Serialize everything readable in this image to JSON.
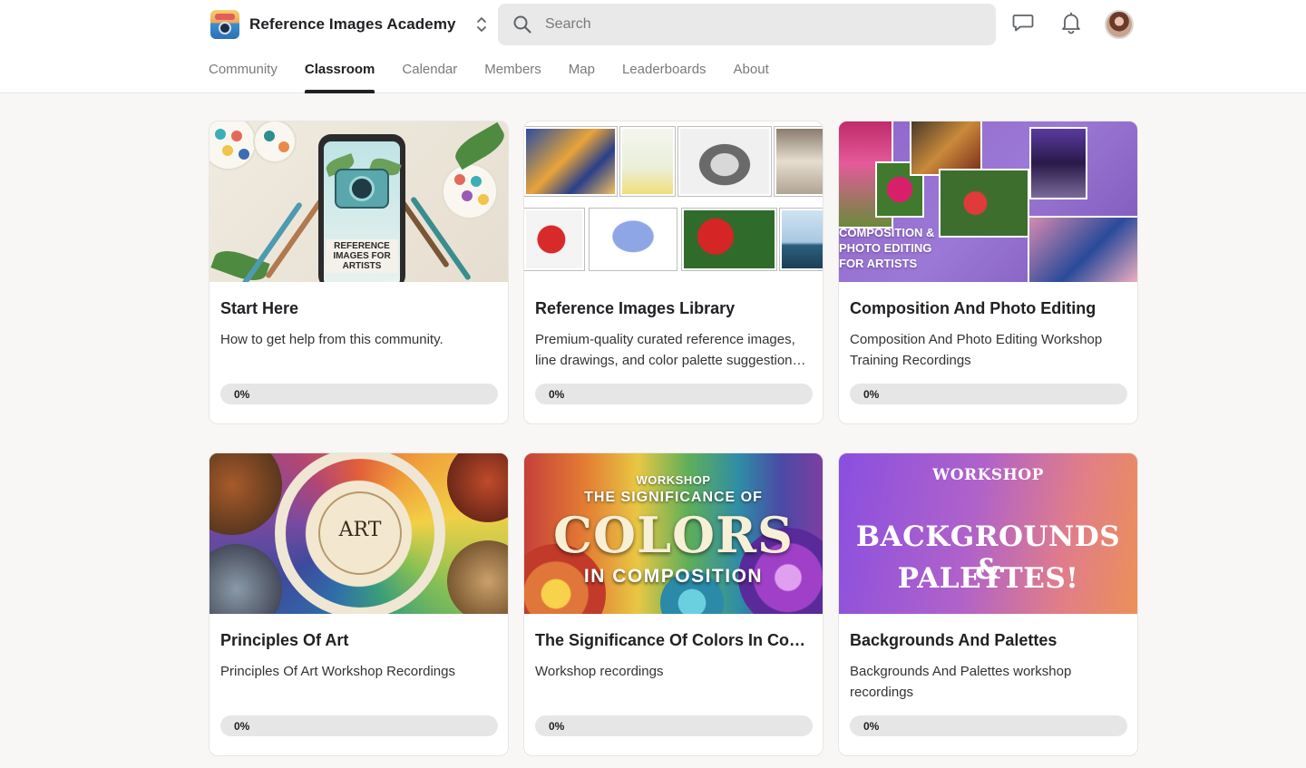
{
  "header": {
    "brand_name": "Reference Images Academy",
    "search_placeholder": "Search"
  },
  "nav": {
    "tabs": [
      {
        "label": "Community",
        "active": false
      },
      {
        "label": "Classroom",
        "active": true
      },
      {
        "label": "Calendar",
        "active": false
      },
      {
        "label": "Members",
        "active": false
      },
      {
        "label": "Map",
        "active": false
      },
      {
        "label": "Leaderboards",
        "active": false
      },
      {
        "label": "About",
        "active": false
      }
    ]
  },
  "courses": [
    {
      "title": "Start Here",
      "description": "How to get help from this community.",
      "progress_label": "0%",
      "progress": 0,
      "thumb_text": "REFERENCE IMAGES FOR ARTISTS"
    },
    {
      "title": "Reference Images Library",
      "description": "Premium-quality curated reference images, line drawings, and color palette suggestions for artists.",
      "progress_label": "0%",
      "progress": 0
    },
    {
      "title": "Composition And Photo Editing",
      "description": "Composition And Photo Editing Workshop Training Recordings",
      "progress_label": "0%",
      "progress": 0,
      "thumb_lines": [
        "COMPOSITION &",
        "PHOTO EDITING",
        "FOR ARTISTS"
      ]
    },
    {
      "title": "Principles Of Art",
      "description": "Principles Of Art Workshop Recordings",
      "progress_label": "0%",
      "progress": 0,
      "thumb_text": "ART"
    },
    {
      "title": "The Significance Of Colors In Composition",
      "description": "Workshop recordings",
      "progress_label": "0%",
      "progress": 0,
      "thumb_lines": [
        "WORKSHOP",
        "THE SIGNIFICANCE OF",
        "COLORS",
        "IN COMPOSITION"
      ]
    },
    {
      "title": "Backgrounds And Palettes",
      "description": "Backgrounds And Palettes workshop recordings",
      "progress_label": "0%",
      "progress": 0,
      "thumb_lines": [
        "WORKSHOP",
        "BACKGROUNDS &",
        "PALETTES!"
      ]
    }
  ],
  "icons": {
    "search": "search-icon",
    "chat": "chat-icon",
    "notifications": "bell-icon",
    "switch": "chevron-up-down-icon"
  }
}
